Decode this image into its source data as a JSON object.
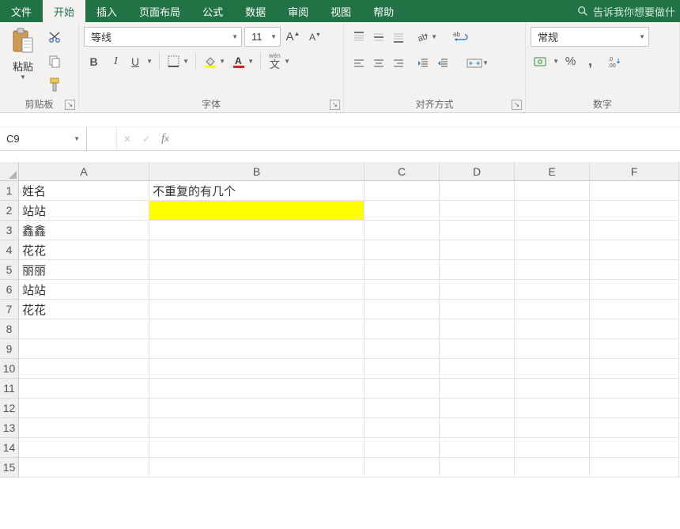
{
  "menu": {
    "items": [
      "文件",
      "开始",
      "插入",
      "页面布局",
      "公式",
      "数据",
      "审阅",
      "视图",
      "帮助"
    ],
    "active_index": 1,
    "search_placeholder": "告诉我你想要做什"
  },
  "ribbon": {
    "clipboard": {
      "paste": "粘贴",
      "label": "剪贴板"
    },
    "font": {
      "name": "等线",
      "size": "11",
      "label": "字体",
      "phonetic": "wén"
    },
    "align": {
      "label": "对齐方式",
      "wrap_code": "ab"
    },
    "number": {
      "format": "常规",
      "label": "数字",
      "percent": "%",
      "comma": ",",
      "dec_inc": ".0",
      "dec_dec": ".00"
    }
  },
  "namebox": "C9",
  "formula": "",
  "columns": [
    "A",
    "B",
    "C",
    "D",
    "E",
    "F"
  ],
  "rows": [
    {
      "n": "1",
      "A": "姓名",
      "B": "不重复的有几个"
    },
    {
      "n": "2",
      "A": "站站",
      "B": "",
      "B_highlight": true
    },
    {
      "n": "3",
      "A": "鑫鑫"
    },
    {
      "n": "4",
      "A": "花花"
    },
    {
      "n": "5",
      "A": "丽丽"
    },
    {
      "n": "6",
      "A": "站站"
    },
    {
      "n": "7",
      "A": "花花"
    },
    {
      "n": "8"
    },
    {
      "n": "9"
    },
    {
      "n": "10"
    },
    {
      "n": "11"
    },
    {
      "n": "12"
    },
    {
      "n": "13"
    },
    {
      "n": "14"
    },
    {
      "n": "15"
    }
  ]
}
